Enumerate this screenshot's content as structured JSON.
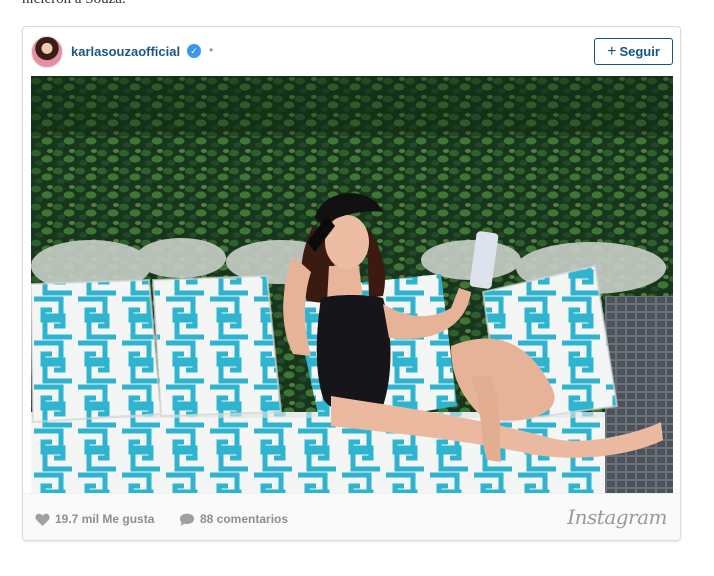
{
  "article": {
    "text_fragment": "hicieron a Souza."
  },
  "post": {
    "username": "karlasouzaofficial",
    "verified_icon": "verified-badge-icon",
    "separator": "•",
    "follow_plus": "+",
    "follow_label": "Seguir",
    "likes_label": "19.7 mil Me gusta",
    "comments_label": "88 comentarios",
    "brand": "Instagram"
  },
  "colors": {
    "username": "#1f5680",
    "follow_border": "#125688",
    "verified": "#3897f0",
    "footer_text": "#8e8e8e",
    "pillow_pattern": "#2fb4cf"
  }
}
